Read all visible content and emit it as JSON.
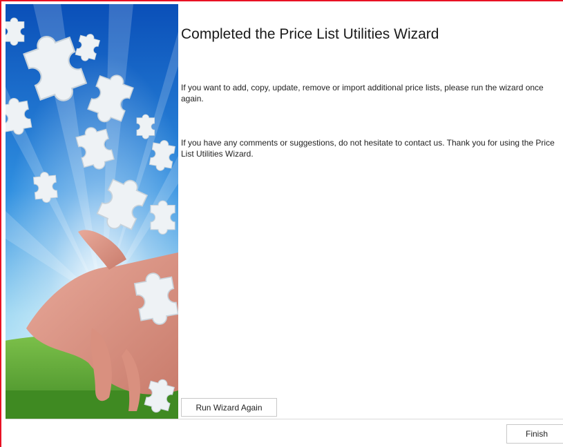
{
  "wizard": {
    "title": "Completed the Price List Utilities Wizard",
    "paragraph1": "If you want to add, copy, update, remove or import additional price lists, please run the wizard once again.",
    "paragraph2": "If you have any comments or suggestions, do not hesitate to contact us. Thank you for using the Price List Utilities Wizard."
  },
  "buttons": {
    "run_again": "Run Wizard Again",
    "finish": "Finish"
  },
  "colors": {
    "frame_border": "#e81123",
    "sky_top": "#0a4fb8",
    "sky_bottom": "#9fd8f2",
    "grass": "#4e9a2a"
  }
}
